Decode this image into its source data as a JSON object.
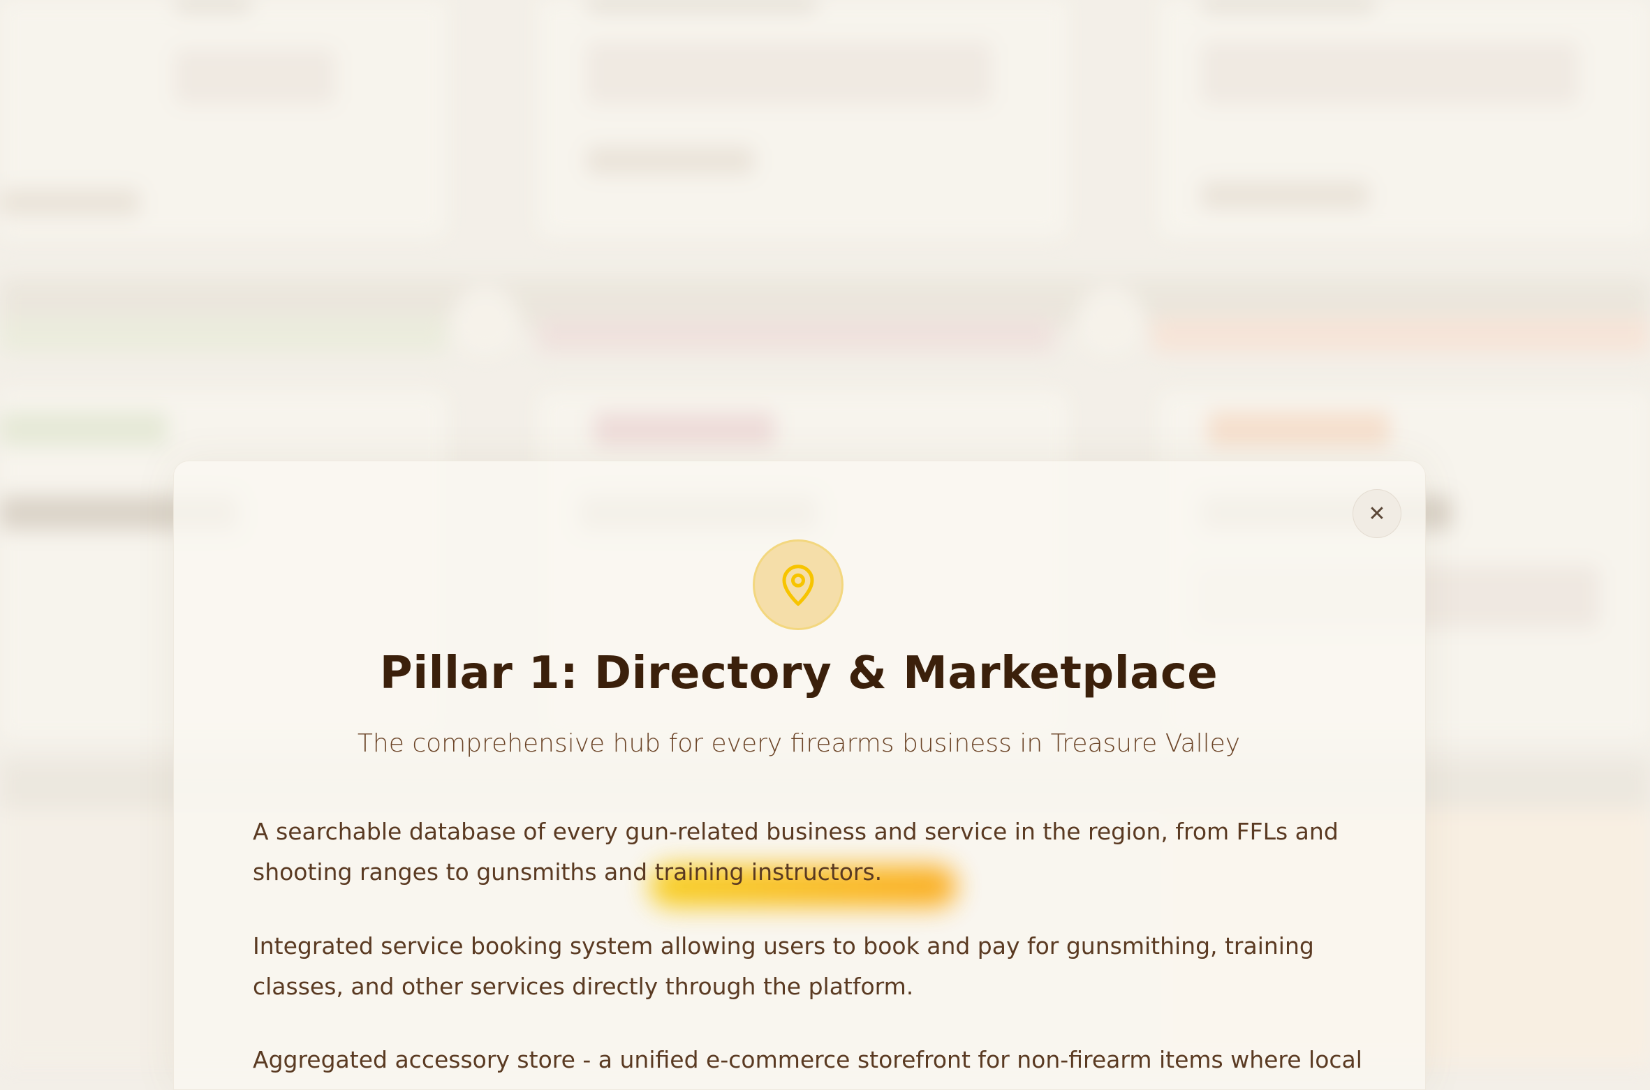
{
  "modal": {
    "icon": "map-pin-icon",
    "close_icon": "close-icon",
    "close_symbol": "✕",
    "title": "Pillar 1: Directory & Marketplace",
    "subtitle": "The comprehensive hub for every firearms business in Treasure Valley",
    "paragraphs": [
      "A searchable database of every gun-related business and service in the region, from FFLs and shooting ranges to gunsmiths and training instructors.",
      "Integrated service booking system allowing users to book and pay for gunsmithing, training classes, and other services directly through the platform.",
      "Aggregated accessory store - a unified e-commerce storefront for non-firearm items where local"
    ]
  },
  "colors": {
    "accent": "#f7c800",
    "accent_orange": "#fba100",
    "title": "#3b200b",
    "text": "#5a3a22"
  }
}
